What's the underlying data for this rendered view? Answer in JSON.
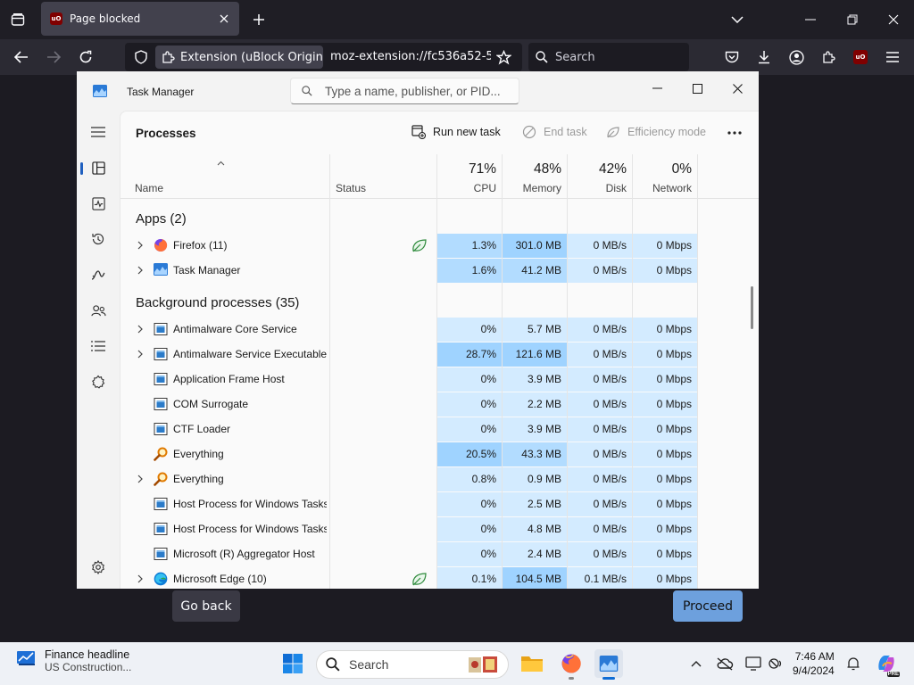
{
  "browser": {
    "tab_title": "Page blocked",
    "ext_chip": "Extension (uBlock Origin)",
    "url": "moz-extension://fc536a52-5",
    "search_placeholder": "Search",
    "ublock_badge": "uO"
  },
  "page": {
    "go_back": "Go back",
    "proceed": "Proceed"
  },
  "taskmanager": {
    "title": "Task Manager",
    "search_placeholder": "Type a name, publisher, or PID...",
    "page_title": "Processes",
    "commands": {
      "run": "Run new task",
      "end": "End task",
      "efficiency": "Efficiency mode"
    },
    "columns": {
      "name": "Name",
      "status": "Status",
      "cpu": {
        "pct": "71%",
        "label": "CPU"
      },
      "memory": {
        "pct": "48%",
        "label": "Memory"
      },
      "disk": {
        "pct": "42%",
        "label": "Disk"
      },
      "network": {
        "pct": "0%",
        "label": "Network"
      }
    },
    "groups": {
      "apps": "Apps (2)",
      "background": "Background processes (35)"
    },
    "apps": [
      {
        "name": "Firefox (11)",
        "cpu": "1.3%",
        "mem": "301.0 MB",
        "disk": "0 MB/s",
        "net": "0 Mbps",
        "icon": "firefox-icon",
        "expand": true,
        "eco": true
      },
      {
        "name": "Task Manager",
        "cpu": "1.6%",
        "mem": "41.2 MB",
        "disk": "0 MB/s",
        "net": "0 Mbps",
        "icon": "task-manager-icon",
        "expand": true,
        "eco": false
      }
    ],
    "background": [
      {
        "name": "Antimalware Core Service",
        "cpu": "0%",
        "mem": "5.7 MB",
        "disk": "0 MB/s",
        "net": "0 Mbps",
        "icon": "service-icon",
        "expand": true
      },
      {
        "name": "Antimalware Service Executable",
        "cpu": "28.7%",
        "mem": "121.6 MB",
        "disk": "0 MB/s",
        "net": "0 Mbps",
        "icon": "service-icon",
        "expand": true
      },
      {
        "name": "Application Frame Host",
        "cpu": "0%",
        "mem": "3.9 MB",
        "disk": "0 MB/s",
        "net": "0 Mbps",
        "icon": "service-icon",
        "expand": false
      },
      {
        "name": "COM Surrogate",
        "cpu": "0%",
        "mem": "2.2 MB",
        "disk": "0 MB/s",
        "net": "0 Mbps",
        "icon": "service-icon",
        "expand": false
      },
      {
        "name": "CTF Loader",
        "cpu": "0%",
        "mem": "3.9 MB",
        "disk": "0 MB/s",
        "net": "0 Mbps",
        "icon": "service-icon",
        "expand": false
      },
      {
        "name": "Everything",
        "cpu": "20.5%",
        "mem": "43.3 MB",
        "disk": "0 MB/s",
        "net": "0 Mbps",
        "icon": "magnifier-icon",
        "expand": false
      },
      {
        "name": "Everything",
        "cpu": "0.8%",
        "mem": "0.9 MB",
        "disk": "0 MB/s",
        "net": "0 Mbps",
        "icon": "magnifier-icon",
        "expand": true
      },
      {
        "name": "Host Process for Windows Tasks",
        "cpu": "0%",
        "mem": "2.5 MB",
        "disk": "0 MB/s",
        "net": "0 Mbps",
        "icon": "service-icon",
        "expand": false
      },
      {
        "name": "Host Process for Windows Tasks",
        "cpu": "0%",
        "mem": "4.8 MB",
        "disk": "0 MB/s",
        "net": "0 Mbps",
        "icon": "service-icon",
        "expand": false
      },
      {
        "name": "Microsoft (R) Aggregator Host",
        "cpu": "0%",
        "mem": "2.4 MB",
        "disk": "0 MB/s",
        "net": "0 Mbps",
        "icon": "service-icon",
        "expand": false
      },
      {
        "name": "Microsoft Edge (10)",
        "cpu": "0.1%",
        "mem": "104.5 MB",
        "disk": "0.1 MB/s",
        "net": "0 Mbps",
        "icon": "edge-icon",
        "expand": true,
        "eco": true
      }
    ]
  },
  "taskbar": {
    "news_title": "Finance headline",
    "news_sub": "US Construction...",
    "search": "Search",
    "time": "7:46 AM",
    "date": "9/4/2024",
    "copilot_badge": "PRE"
  },
  "colors": {
    "heat_light": "#d3ebff",
    "heat_medium": "#b2dcff",
    "heat_strong": "#9fd3ff",
    "proceed": "#6da0dd"
  }
}
